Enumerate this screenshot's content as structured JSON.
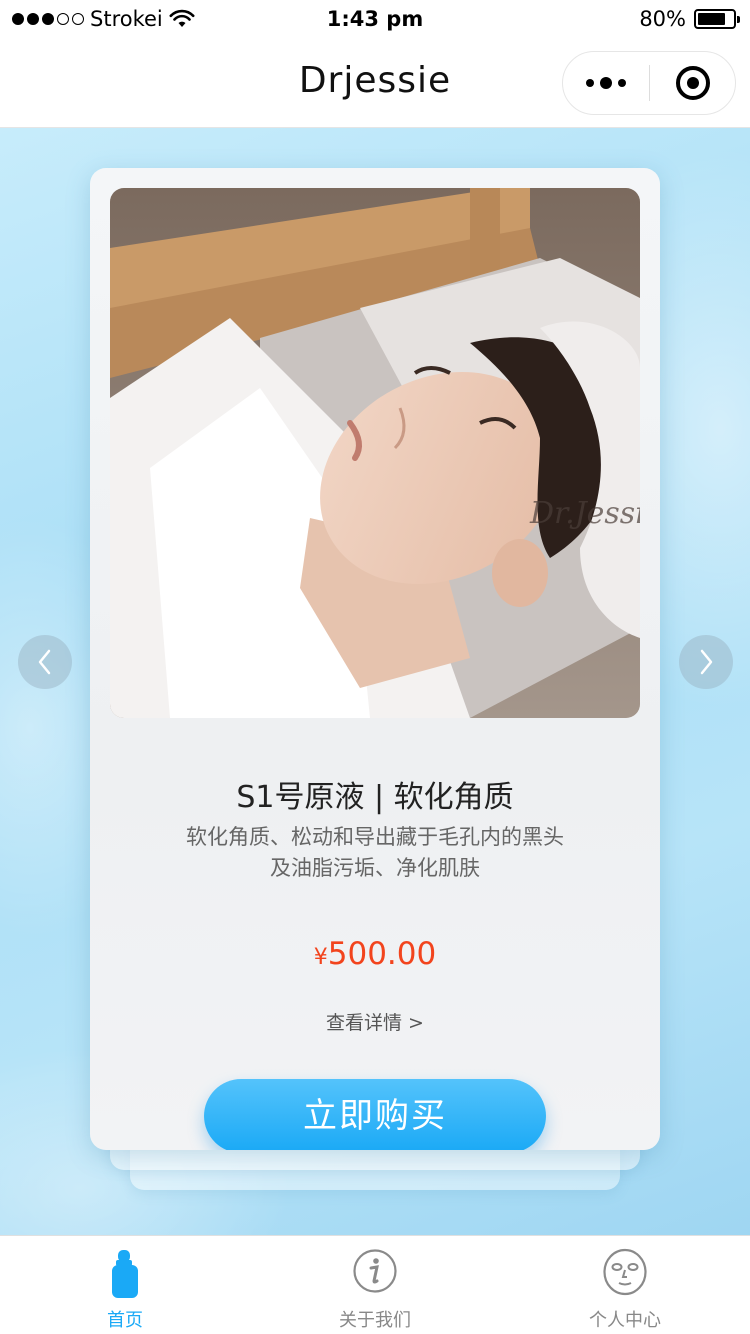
{
  "status_bar": {
    "carrier": "Strokei",
    "time": "1:43 pm",
    "battery": "80%",
    "battery_level": 0.8
  },
  "nav": {
    "title": "Drjessie"
  },
  "product": {
    "title": "S1号原液 | 软化角质",
    "desc_line1": "软化角质、松动和导出藏于毛孔内的黑头",
    "desc_line2": "及油脂污垢、净化肌肤",
    "currency": "¥",
    "price": "500.00",
    "detail_link": "查看详情 >",
    "buy_label": "立即购买",
    "watermark": "Dr.Jessie"
  },
  "tabs": [
    {
      "label": "首页",
      "icon": "bottle-icon",
      "active": true
    },
    {
      "label": "关于我们",
      "icon": "info-icon",
      "active": false
    },
    {
      "label": "个人中心",
      "icon": "face-mask-icon",
      "active": false
    }
  ],
  "colors": {
    "accent": "#1aa9f6",
    "price": "#f2441d",
    "background": "#b7e4f8"
  }
}
